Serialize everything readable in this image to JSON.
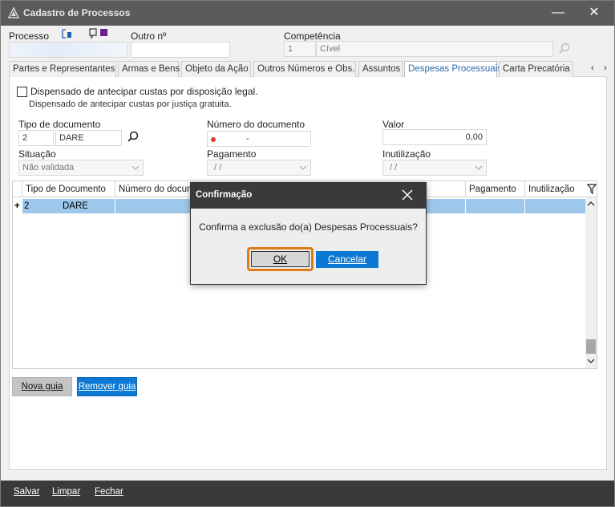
{
  "window": {
    "title": "Cadastro de Processos",
    "minimize_glyph": "—",
    "close_glyph": "✕"
  },
  "header": {
    "processo_label": "Processo",
    "processo_value": "",
    "outro_label": "Outro nº",
    "outro_value": "",
    "competencia_label": "Competência",
    "competencia_code": "1",
    "competencia_value": "Cível"
  },
  "tabs": [
    {
      "label": "Partes e Representantes"
    },
    {
      "label": "Armas e Bens"
    },
    {
      "label": "Objeto da Ação"
    },
    {
      "label": "Outros Números e Obs."
    },
    {
      "label": "Assuntos"
    },
    {
      "label": "Despesas Processuais"
    },
    {
      "label": "Carta Precatória"
    }
  ],
  "tab_arrows": {
    "left": "‹",
    "right": "›"
  },
  "form": {
    "dispensado_checkbox_label": "Dispensado de antecipar custas por disposição legal.",
    "dispensado_note": "Dispensado de antecipar custas por justiça gratuita.",
    "tipo_doc_label": "Tipo de documento",
    "tipo_doc_code": "2",
    "tipo_doc_value": "DARE",
    "numero_doc_label": "Número do documento",
    "numero_doc_value": "-",
    "valor_label": "Valor",
    "valor_value": "0,00",
    "situacao_label": "Situação",
    "situacao_value": "Não validada",
    "pagamento_label": "Pagamento",
    "pagamento_value": "/ /",
    "inutilizacao_label": "Inutilização",
    "inutilizacao_value": "/ /"
  },
  "grid": {
    "columns": [
      "Tipo de Documento",
      "Número do documento",
      "Pagamento",
      "Inutilização"
    ],
    "rows": [
      {
        "expander": "+",
        "code": "2",
        "tipo": "DARE"
      }
    ]
  },
  "actions": {
    "nova_guia": "Nova guia",
    "remover_guia": "Remover guia"
  },
  "footer": {
    "salvar": "Salvar",
    "limpar": "Limpar",
    "fechar": "Fechar"
  },
  "dialog": {
    "title": "Confirmação",
    "message": "Confirma a exclusão do(a) Despesas Processuais?",
    "ok": "OK",
    "cancel": "Cancelar"
  },
  "colors": {
    "titlebar": "#5b5b5b",
    "accent_blue": "#0b78d4",
    "selected_row": "#9dc8ec",
    "focus_ring": "#e07a14",
    "footer": "#3a3a3a"
  }
}
